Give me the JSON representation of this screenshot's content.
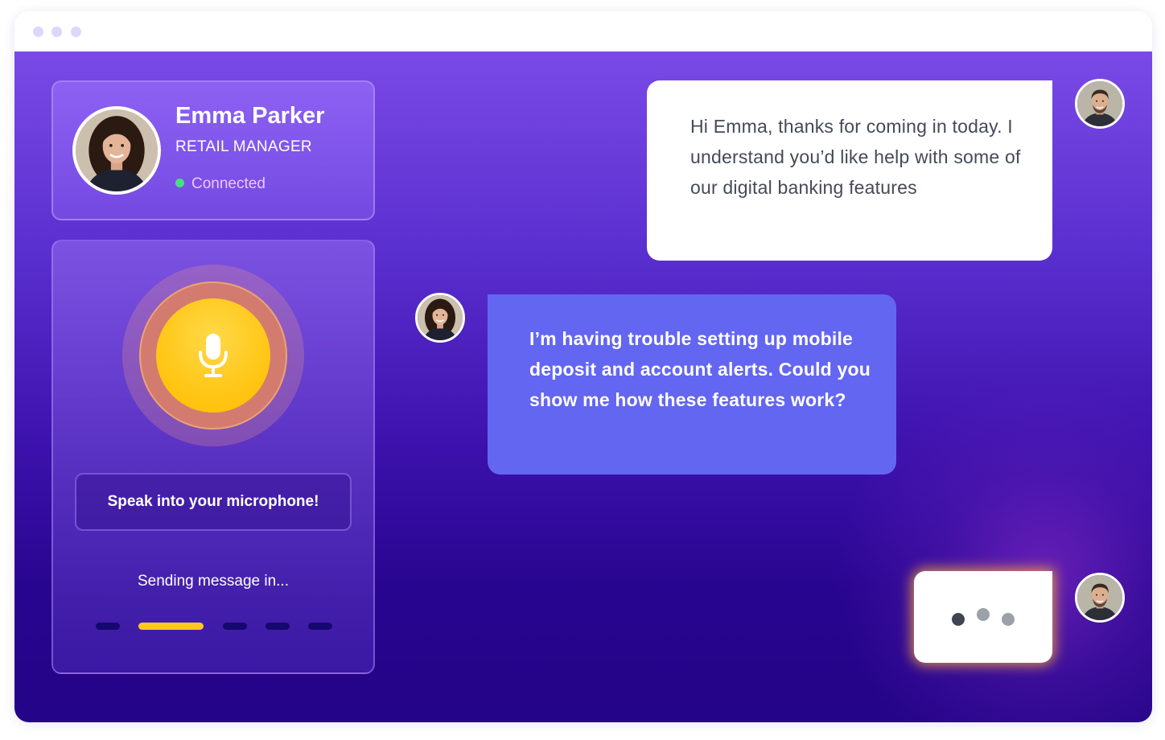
{
  "window": {
    "controls": [
      "close",
      "minimize",
      "maximize"
    ]
  },
  "profile": {
    "name": "Emma Parker",
    "role": "RETAIL MANAGER",
    "status": "Connected",
    "status_color": "#4ade80",
    "avatar": "woman-portrait-avatar"
  },
  "voice": {
    "mic_icon": "microphone-icon",
    "prompt": "Speak into your microphone!",
    "sending_label": "Sending message in...",
    "countdown_active_fraction": 0.2,
    "accent_color": "#ffc81a"
  },
  "chat": {
    "messages": [
      {
        "sender": "agent",
        "avatar": "man-portrait-avatar",
        "text": "Hi Emma, thanks for coming in today. I understand you’d like help with some of our digital banking features"
      },
      {
        "sender": "user",
        "avatar": "woman-portrait-avatar",
        "text": "I’m having trouble setting up mobile deposit and account alerts. Could you show me how these features work?"
      }
    ],
    "typing": {
      "sender": "agent",
      "avatar": "man-portrait-avatar"
    },
    "user_bubble_color": "#6366f1"
  }
}
